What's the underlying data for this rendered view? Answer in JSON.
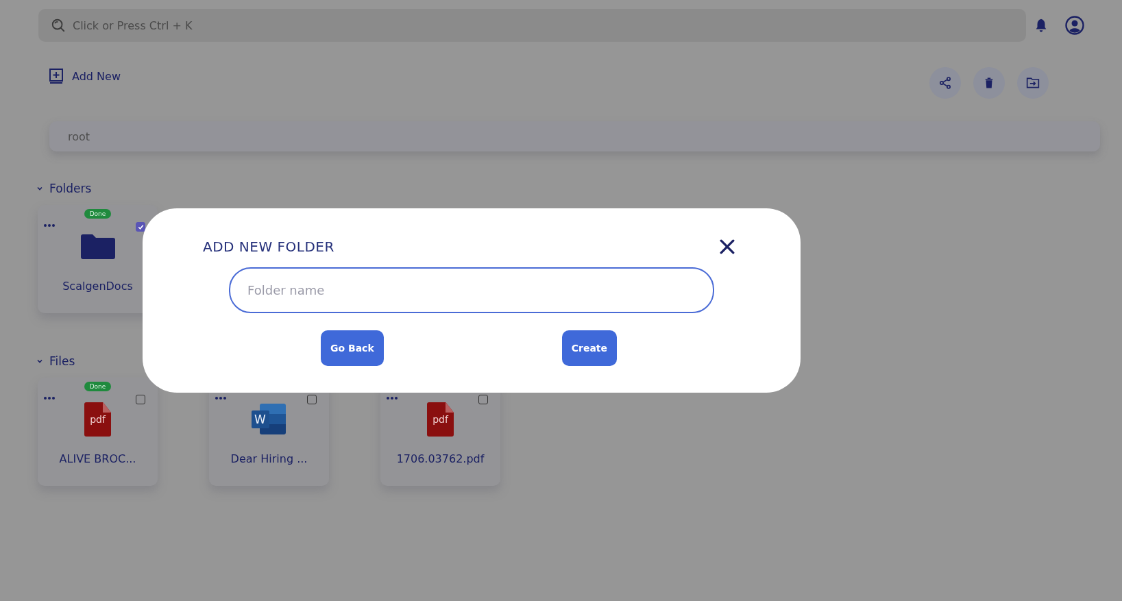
{
  "search": {
    "placeholder": "Click or Press Ctrl + K"
  },
  "add_new": "Add New",
  "breadcrumb": "root",
  "folders": {
    "title": "Folders",
    "expanded": true,
    "items": [
      {
        "name": "ScalgenDocs",
        "badge": "Done",
        "checked": true
      }
    ]
  },
  "files": {
    "title": "Files",
    "expanded": true,
    "items": [
      {
        "kind": "pdf",
        "name": "ALIVE BROC...",
        "badge": "Done",
        "checked": false,
        "icon_text": "pdf"
      },
      {
        "kind": "word",
        "name": "Dear Hiring ...",
        "checked": false,
        "icon_text": "W"
      },
      {
        "kind": "pdf",
        "name": "1706.03762.pdf",
        "checked": false,
        "icon_text": "pdf"
      }
    ]
  },
  "dialog": {
    "title": "ADD NEW FOLDER",
    "field": {
      "placeholder": "Folder name"
    },
    "buttons": [
      "Go Back",
      "Create"
    ]
  }
}
